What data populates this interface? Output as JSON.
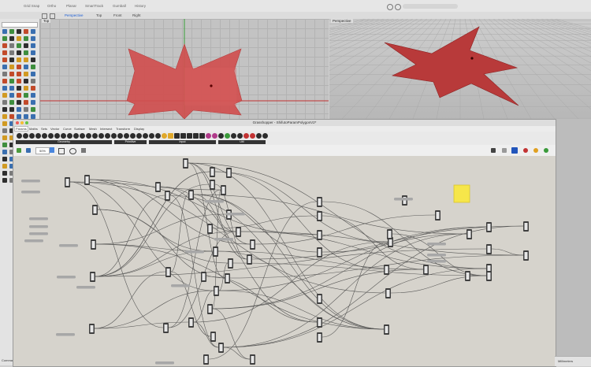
{
  "topbar": {
    "items": [
      "Grid Snap",
      "Ortho",
      "Planar",
      "SmartTrack",
      "Gumball",
      "History"
    ]
  },
  "viewport_tabs": [
    "Perspective",
    "Top",
    "Front",
    "Right"
  ],
  "viewports": {
    "top_label": "Top",
    "persp_label": "Perspective"
  },
  "grasshopper": {
    "title": "Grasshopper - ShifutoParamPolygonV2*",
    "menu": [
      "Params",
      "Maths",
      "Sets",
      "Vector",
      "Curve",
      "Surface",
      "Mesh",
      "Intersect",
      "Transform",
      "Display"
    ],
    "ribbon_groups": [
      "Geometry",
      "Primitive",
      "Input",
      "Util"
    ],
    "zoom": "50%"
  },
  "sidebar": {
    "labels": [
      "Commands"
    ]
  },
  "status": {
    "units": "Millimeters"
  },
  "colors": {
    "shape_fill": "#c94040",
    "accent": "#1d5fd6",
    "panel_yellow": "#f6e64a"
  }
}
